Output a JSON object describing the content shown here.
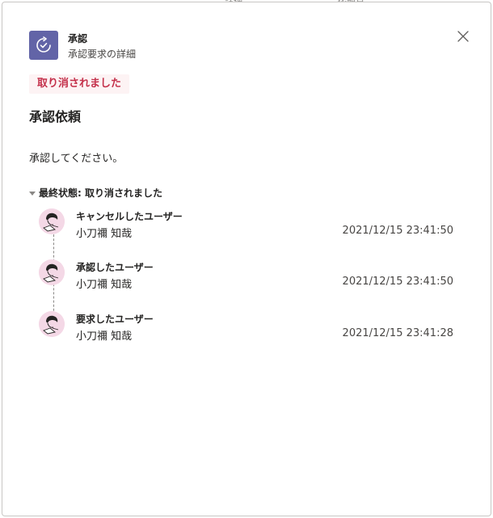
{
  "background": {
    "tabs": [
      "詳細",
      "依頼日"
    ]
  },
  "header": {
    "app_name": "承認",
    "subtitle": "承認要求の詳細",
    "icon": "approval-refresh-icon",
    "accent_color": "#6264a7"
  },
  "status": {
    "label": "取り消されました",
    "color": "#c4314b"
  },
  "request": {
    "title": "承認依頼",
    "message": "承認してください。"
  },
  "timeline": {
    "header": "最終状態: 取り消されました",
    "entries": [
      {
        "role": "キャンセルしたユーザー",
        "name": "小刀禰 知哉",
        "time": "2021/12/15 23:41:50"
      },
      {
        "role": "承認したユーザー",
        "name": "小刀禰 知哉",
        "time": "2021/12/15 23:41:50"
      },
      {
        "role": "要求したユーザー",
        "name": "小刀禰 知哉",
        "time": "2021/12/15 23:41:28"
      }
    ]
  }
}
